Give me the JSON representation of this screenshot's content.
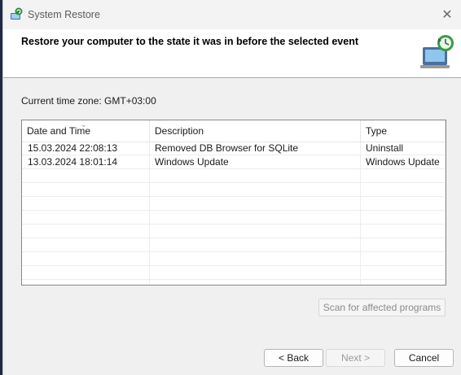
{
  "window": {
    "title": "System Restore",
    "close_glyph": "✕",
    "app_icon": "system-restore-icon"
  },
  "header": {
    "text": "Restore your computer to the state it was in before the selected event",
    "icon": "system-restore-computer-icon"
  },
  "timezone": "Current time zone: GMT+03:00",
  "list": {
    "columns": [
      "Date and Time",
      "Description",
      "Type"
    ],
    "sort_glyph": "⌄",
    "rows": [
      {
        "date": "15.03.2024 22:08:13",
        "description": "Removed DB Browser for SQLite",
        "type": "Uninstall"
      },
      {
        "date": "13.03.2024 18:01:14",
        "description": "Windows Update",
        "type": "Windows Update"
      }
    ]
  },
  "buttons": {
    "scan": "Scan for affected programs",
    "back": "< Back",
    "next": "Next >",
    "cancel": "Cancel"
  },
  "colors": {
    "accent": "#2e8b3a",
    "header_bg": "#ffffff",
    "window_bg": "#f0f0f0"
  }
}
